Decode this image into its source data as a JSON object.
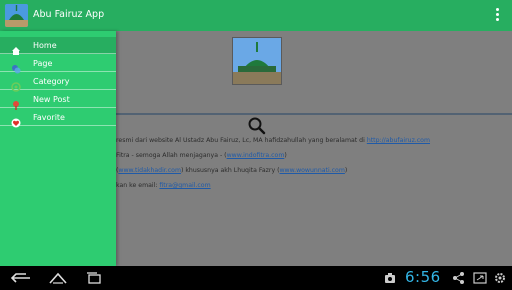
{
  "app": {
    "title": "Abu Fairuz App",
    "accent": "#27ae60",
    "drawer_color": "#2ecc71",
    "overflow_icon": "more-vert-icon"
  },
  "drawer": {
    "items": [
      {
        "label": "Home",
        "icon": "home-icon",
        "active": true
      },
      {
        "label": "Page",
        "icon": "page-icon"
      },
      {
        "label": "Category",
        "icon": "category-icon"
      },
      {
        "label": "New Post",
        "icon": "new-post-icon"
      },
      {
        "label": "Favorite",
        "icon": "favorite-icon"
      }
    ]
  },
  "content": {
    "search_icon": "search-icon",
    "para1": {
      "text": "resmi dari website Al Ustadz Abu Fairuz, Lc, MA hafidzahullah yang beralamat di ",
      "link": "http://abufairuz.com"
    },
    "para2": {
      "text": "Fitra - semoga Allah menjaganya - (",
      "link": "www.indofitra.com",
      "end": ")"
    },
    "para3": {
      "text": "(",
      "link": "www.tidakhadir.com",
      "mid": ") khususnya akh Lhuqita Fazry (",
      "link2": "www.wowunnati.com",
      "end": ")"
    },
    "para4": {
      "text": "kan ke email: ",
      "link": "fitra@gmail.com"
    }
  },
  "statusbar": {
    "time": "6:56",
    "clock_color": "#33b5e5",
    "left_icons": [
      "back-icon",
      "home-nav-icon",
      "recents-icon"
    ],
    "right_icons": [
      "screenshot-icon",
      "share-icon",
      "fullscreen-icon",
      "settings-icon"
    ]
  }
}
